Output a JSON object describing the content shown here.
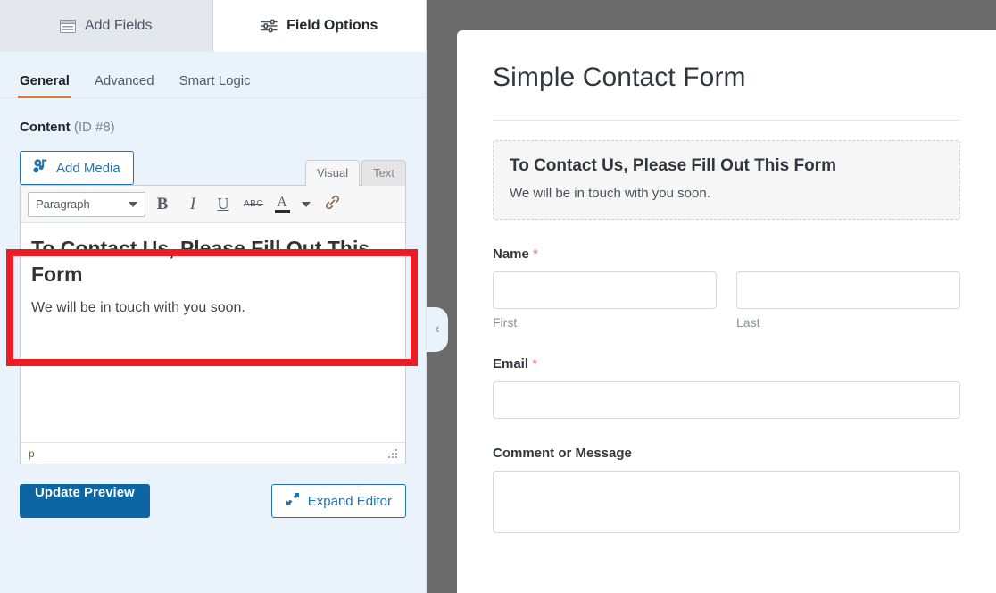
{
  "builder": {
    "tabs": [
      {
        "label": "Add Fields",
        "icon": "fields-list-icon",
        "active": false
      },
      {
        "label": "Field Options",
        "icon": "sliders-icon",
        "active": true
      }
    ],
    "subtabs": [
      {
        "label": "General",
        "active": true
      },
      {
        "label": "Advanced",
        "active": false
      },
      {
        "label": "Smart Logic",
        "active": false
      }
    ],
    "content_section": {
      "label": "Content",
      "id_text": "(ID #8)"
    },
    "add_media_label": "Add Media",
    "editor_tabs": [
      {
        "label": "Visual",
        "active": true
      },
      {
        "label": "Text",
        "active": false
      }
    ],
    "toolbar": {
      "format_value": "Paragraph",
      "bold": "B",
      "italic": "I",
      "underline": "U",
      "strikethrough": "ABC",
      "text_color": "A",
      "link": "link-icon"
    },
    "editor_content": {
      "heading": "To Contact Us, Please Fill Out This Form",
      "paragraph": "We will be in touch with you soon."
    },
    "editor_status_path": "p",
    "buttons": {
      "update_preview": "Update Preview",
      "expand_editor": "Expand Editor"
    },
    "collapse_chevron": "‹"
  },
  "preview": {
    "title": "Simple Contact Form",
    "html_block": {
      "heading": "To Contact Us, Please Fill Out This Form",
      "paragraph": "We will be in touch with you soon."
    },
    "fields": {
      "name": {
        "label": "Name",
        "required_mark": "*",
        "sub_first": "First",
        "sub_last": "Last",
        "first_value": "",
        "last_value": ""
      },
      "email": {
        "label": "Email",
        "required_mark": "*",
        "value": ""
      },
      "comment": {
        "label": "Comment or Message",
        "value": ""
      }
    }
  },
  "colors": {
    "accent_orange": "#e27730",
    "link_blue": "#2271b1",
    "primary_blue": "#0b66a3",
    "panel_bg": "#eaf2fb",
    "overlay_gray": "#6b6b6b",
    "annotation_red": "#ed1c24",
    "required_red": "#e27272"
  }
}
